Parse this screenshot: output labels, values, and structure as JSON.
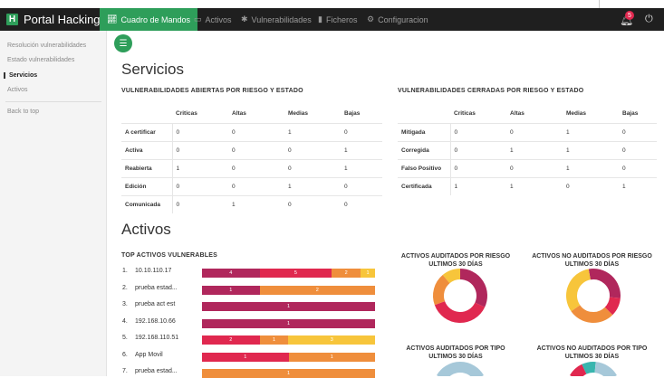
{
  "colors": {
    "brand_green": "#2e9e5a",
    "navbar_bg": "#1f1f1f",
    "critica": "#b0275c",
    "alta": "#e0284f",
    "media": "#ef8e3c",
    "baja": "#f7c53b",
    "donut_blue": "#a6c8d9",
    "donut_teal": "#38b5ae"
  },
  "navbar": {
    "brand": "Portal Hacking",
    "brand_logo": "H",
    "tabs": [
      {
        "label": "Cuadro de Mandos",
        "icon": "chart-line-icon",
        "active": true
      },
      {
        "label": "Activos",
        "icon": "monitor-icon",
        "active": false
      },
      {
        "label": "Vulnerabilidades",
        "icon": "bug-icon",
        "active": false
      },
      {
        "label": "Ficheros",
        "icon": "file-icon",
        "active": false
      },
      {
        "label": "Configuracion",
        "icon": "gears-icon",
        "active": false
      }
    ],
    "notifications_count": "5"
  },
  "sidebar": {
    "items": [
      {
        "label": "Resolución vulnerabilidades",
        "active": false
      },
      {
        "label": "Estado vulnerabilidades",
        "active": false
      },
      {
        "label": "Servicios",
        "active": true
      },
      {
        "label": "Activos",
        "active": false
      }
    ],
    "back_to_top": "Back to top"
  },
  "servicios": {
    "title": "Servicios",
    "abiertas": {
      "title": "VULNERABILIDADES ABIERTAS POR RIESGO Y ESTADO",
      "columns": [
        "Criticas",
        "Altas",
        "Medias",
        "Bajas"
      ],
      "rows": [
        {
          "label": "A certificar",
          "values": [
            "0",
            "0",
            "1",
            "0"
          ]
        },
        {
          "label": "Activa",
          "values": [
            "0",
            "0",
            "0",
            "1"
          ]
        },
        {
          "label": "Reabierta",
          "values": [
            "1",
            "0",
            "0",
            "1"
          ]
        },
        {
          "label": "Edición",
          "values": [
            "0",
            "0",
            "1",
            "0"
          ]
        },
        {
          "label": "Comunicada",
          "values": [
            "0",
            "1",
            "0",
            "0"
          ]
        }
      ]
    },
    "cerradas": {
      "title": "VULNERABILIDADES CERRADAS POR RIESGO Y ESTADO",
      "columns": [
        "Criticas",
        "Altas",
        "Medias",
        "Bajas"
      ],
      "rows": [
        {
          "label": "Mitigada",
          "values": [
            "0",
            "0",
            "1",
            "0"
          ]
        },
        {
          "label": "Corregida",
          "values": [
            "0",
            "1",
            "1",
            "0"
          ]
        },
        {
          "label": "Falso Positivo",
          "values": [
            "0",
            "0",
            "1",
            "0"
          ]
        },
        {
          "label": "Certificada",
          "values": [
            "1",
            "1",
            "0",
            "1"
          ]
        }
      ]
    }
  },
  "activos": {
    "title": "Activos",
    "top_title": "TOP ACTIVOS VULNERABLES",
    "top": [
      {
        "num": "1.",
        "name": "10.10.110.17",
        "segments": [
          {
            "risk": "critica",
            "value": 4
          },
          {
            "risk": "alta",
            "value": 5
          },
          {
            "risk": "media",
            "value": 2
          },
          {
            "risk": "baja",
            "value": 1
          }
        ]
      },
      {
        "num": "2.",
        "name": "prueba estad...",
        "segments": [
          {
            "risk": "critica",
            "value": 1
          },
          {
            "risk": "media",
            "value": 2
          }
        ]
      },
      {
        "num": "3.",
        "name": "prueba act est",
        "segments": [
          {
            "risk": "critica",
            "value": 1
          }
        ]
      },
      {
        "num": "4.",
        "name": "192.168.10.66",
        "segments": [
          {
            "risk": "critica",
            "value": 1
          }
        ]
      },
      {
        "num": "5.",
        "name": "192.168.110.51",
        "segments": [
          {
            "risk": "alta",
            "value": 2
          },
          {
            "risk": "media",
            "value": 1
          },
          {
            "risk": "baja",
            "value": 3
          }
        ]
      },
      {
        "num": "6.",
        "name": "App Movil",
        "segments": [
          {
            "risk": "alta",
            "value": 1
          },
          {
            "risk": "media",
            "value": 1
          }
        ]
      },
      {
        "num": "7.",
        "name": "prueba estad...",
        "segments": [
          {
            "risk": "media",
            "value": 1
          }
        ]
      }
    ],
    "donuts": [
      {
        "title_line1": "ACTIVOS AUDITADOS POR RIESGO",
        "title_line2": "ULTIMOS 30 DÍAS"
      },
      {
        "title_line1": "ACTIVOS NO AUDITADOS POR RIESGO",
        "title_line2": "ULTIMOS 30 DÍAS"
      },
      {
        "title_line1": "ACTIVOS AUDITADOS POR TIPO",
        "title_line2": "ULTIMOS 30 DÍAS"
      },
      {
        "title_line1": "ACTIVOS NO AUDITADOS POR TIPO",
        "title_line2": "ULTIMOS 30 DÍAS"
      }
    ]
  }
}
